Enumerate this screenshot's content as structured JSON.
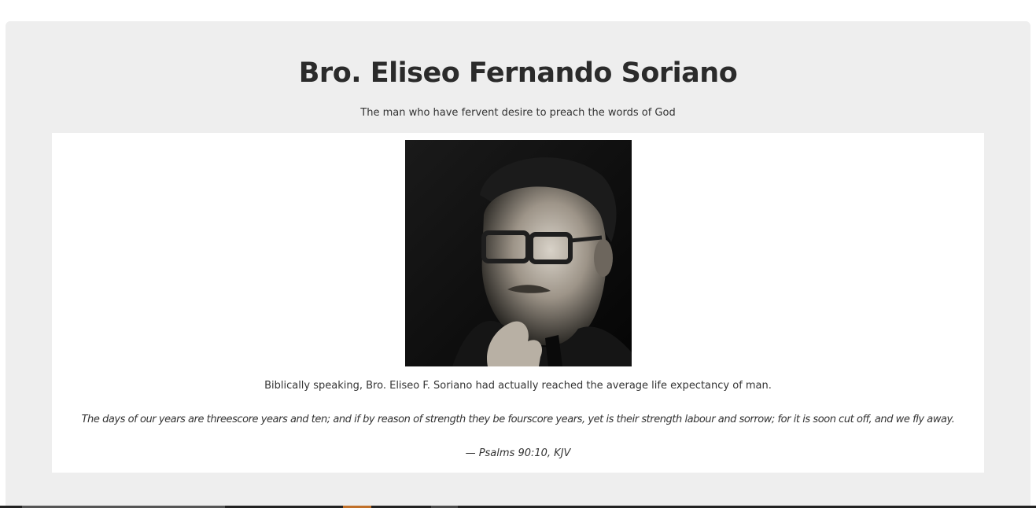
{
  "header": {
    "title": "Bro. Eliseo Fernando Soriano",
    "subtitle": "The man who have fervent desire to preach the words of God"
  },
  "content": {
    "portrait_icon": "portrait-photo-icon",
    "caption": "Biblically speaking, Bro. Eliseo F. Soriano had actually reached the average life expectancy of man.",
    "quote": "The days of our years are threescore years and ten; and if by reason of strength they be fourscore years, yet is their strength labour and sorrow; for it is soon cut off, and we fly away.",
    "citation": "— Psalms 90:10, KJV"
  },
  "colors": {
    "background": "#eeeeee",
    "panel": "#ffffff",
    "text": "#333333",
    "accent": "#c0702a"
  }
}
